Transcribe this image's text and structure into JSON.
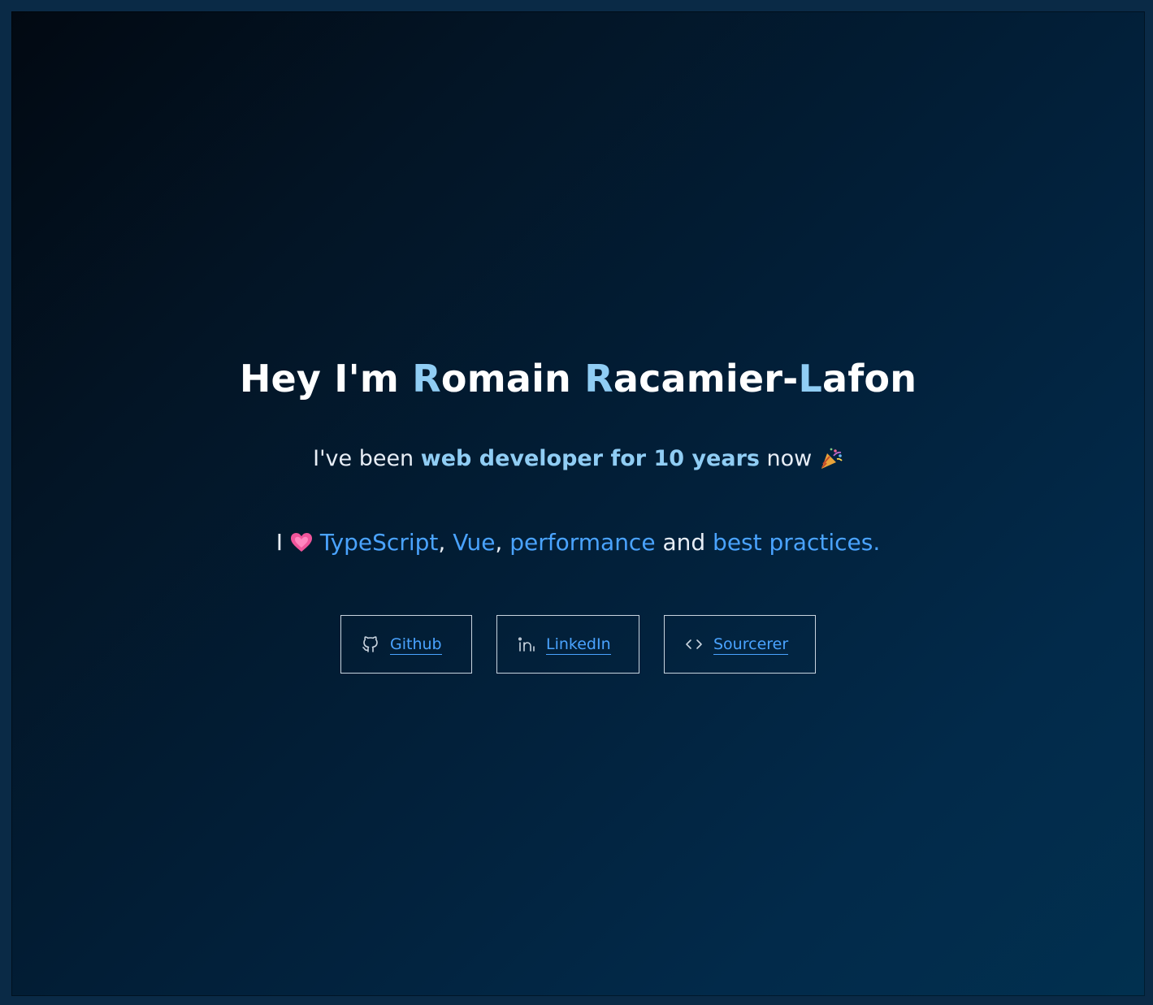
{
  "hero": {
    "title": {
      "prefix": "Hey I'm ",
      "first_initial": "R",
      "first_rest": "omain ",
      "last_initial_1": "R",
      "last_rest_1": "acamier-",
      "last_initial_2": "L",
      "last_rest_2": "afon"
    },
    "tagline": {
      "before": "I've been ",
      "highlight": "web developer for 10 years",
      "after": " now ",
      "emoji_icon": "party-popper-icon"
    },
    "loves": {
      "prefix": "I ",
      "heart_icon": "heart-icon",
      "tech_1": "TypeScript",
      "sep_1": ", ",
      "tech_2": "Vue",
      "sep_2": ", ",
      "tech_3": "performance",
      "sep_3": " and ",
      "tech_4": "best practices."
    }
  },
  "links": [
    {
      "label": "Github",
      "icon": "github-icon"
    },
    {
      "label": "LinkedIn",
      "icon": "linkedin-icon"
    },
    {
      "label": "Sourcerer",
      "icon": "code-brackets-icon"
    }
  ],
  "colors": {
    "accent_light": "#90cdf4",
    "accent_link": "#4aa3ff",
    "text": "#ffffff",
    "border": "#c9d4df"
  }
}
